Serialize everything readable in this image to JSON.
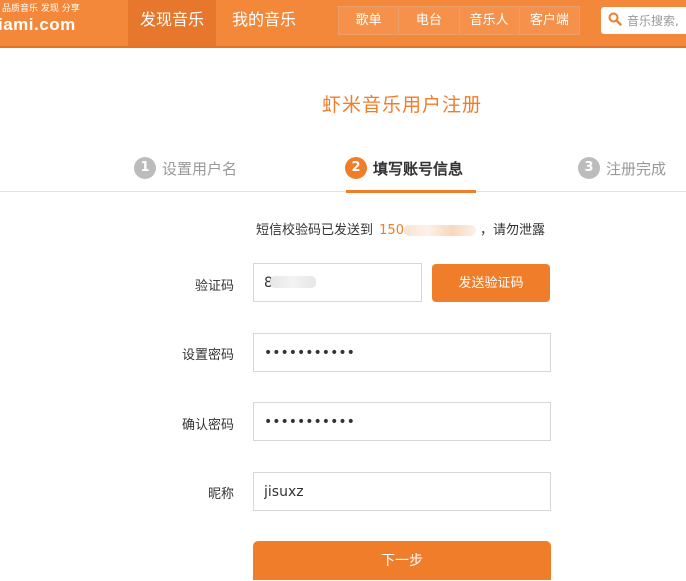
{
  "header": {
    "logo_tagline": "品质音乐 发现 分享",
    "logo_name": "iami.com",
    "nav": {
      "discover": "发现音乐",
      "mine": "我的音乐"
    },
    "subnav": [
      "歌单",
      "电台",
      "音乐人",
      "客户端"
    ],
    "search_placeholder": "音乐搜索,"
  },
  "page": {
    "title": "虾米音乐用户注册",
    "steps": [
      {
        "number": "1",
        "label": "设置用户名",
        "state": "done"
      },
      {
        "number": "2",
        "label": "填写账号信息",
        "state": "active"
      },
      {
        "number": "3",
        "label": "注册完成",
        "state": "pending"
      }
    ]
  },
  "form": {
    "sent_prefix": "短信校验码已发送到",
    "phone_visible": "150",
    "sent_suffix": "，请勿泄露",
    "code_label": "验证码",
    "code_value": "8",
    "send_code_button": "发送验证码",
    "password_label": "设置密码",
    "password_value": "•••••••••••",
    "confirm_label": "确认密码",
    "confirm_value": "•••••••••••",
    "nickname_label": "昵称",
    "nickname_value": "jisuxz",
    "next_button": "下一步"
  },
  "colors": {
    "brand_orange": "#f3873a",
    "accent": "#f07d2a",
    "step_inactive": "#bcbcbc"
  }
}
